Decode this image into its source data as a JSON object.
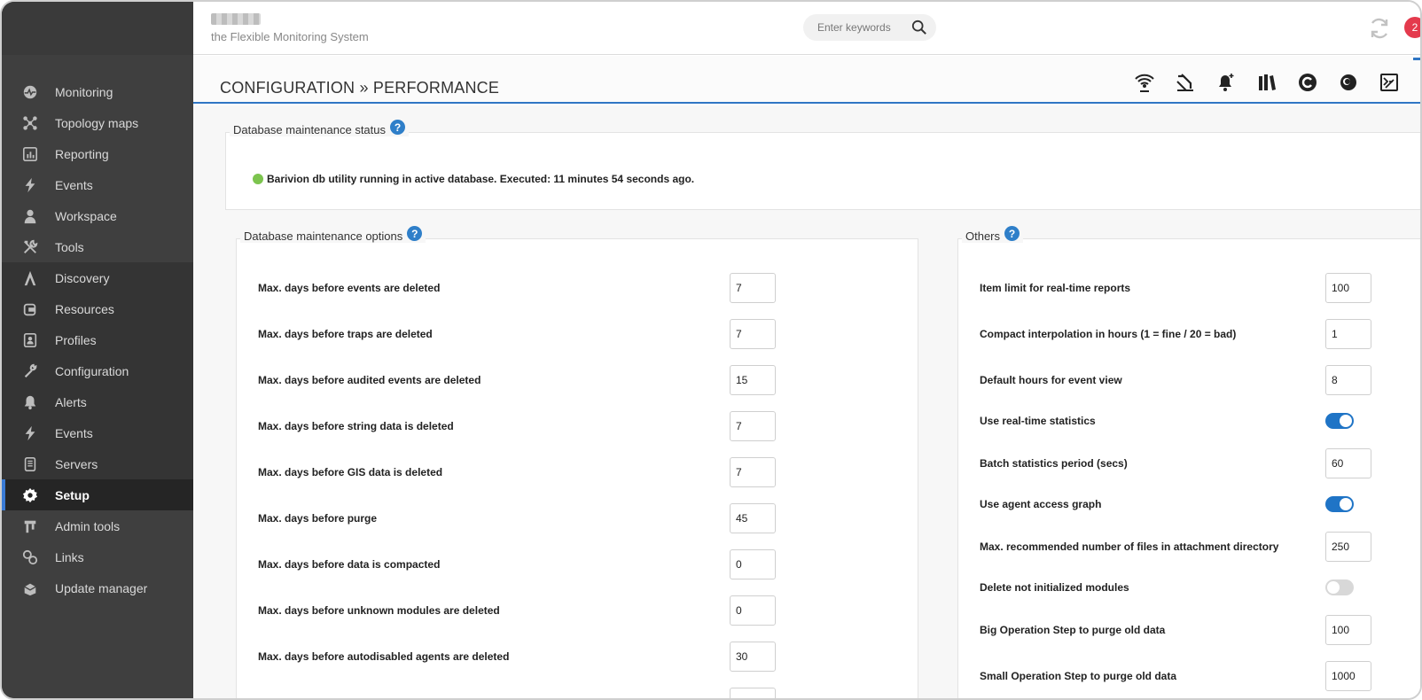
{
  "header": {
    "tagline": "the Flexible Monitoring System",
    "search_placeholder": "Enter keywords",
    "notification_count": "2"
  },
  "page": {
    "title": "CONFIGURATION » PERFORMANCE"
  },
  "sidebar": {
    "items": [
      {
        "label": "Monitoring",
        "icon": "monitoring-icon"
      },
      {
        "label": "Topology maps",
        "icon": "topology-icon"
      },
      {
        "label": "Reporting",
        "icon": "reporting-icon"
      },
      {
        "label": "Events",
        "icon": "events-icon"
      },
      {
        "label": "Workspace",
        "icon": "workspace-icon"
      },
      {
        "label": "Tools",
        "icon": "tools-icon"
      },
      {
        "label": "Discovery",
        "icon": "discovery-icon"
      },
      {
        "label": "Resources",
        "icon": "resources-icon"
      },
      {
        "label": "Profiles",
        "icon": "profiles-icon"
      },
      {
        "label": "Configuration",
        "icon": "wrench-icon"
      },
      {
        "label": "Alerts",
        "icon": "bell-icon"
      },
      {
        "label": "Events",
        "icon": "events-icon"
      },
      {
        "label": "Servers",
        "icon": "servers-icon"
      },
      {
        "label": "Setup",
        "icon": "gear-icon",
        "active": true
      },
      {
        "label": "Admin tools",
        "icon": "admin-tools-icon"
      },
      {
        "label": "Links",
        "icon": "links-icon"
      },
      {
        "label": "Update manager",
        "icon": "update-manager-icon"
      }
    ]
  },
  "db_status": {
    "legend": "Database maintenance status",
    "message": "Barivion db utility running in active database. Executed: 11 minutes 54 seconds ago.",
    "status_color": "#7cc44e"
  },
  "db_options": {
    "legend": "Database maintenance options",
    "rows": [
      {
        "label": "Max. days before events are deleted",
        "value": "7"
      },
      {
        "label": "Max. days before traps are deleted",
        "value": "7"
      },
      {
        "label": "Max. days before audited events are deleted",
        "value": "15"
      },
      {
        "label": "Max. days before string data is deleted",
        "value": "7"
      },
      {
        "label": "Max. days before GIS data is deleted",
        "value": "7"
      },
      {
        "label": "Max. days before purge",
        "value": "45"
      },
      {
        "label": "Max. days before data is compacted",
        "value": "0"
      },
      {
        "label": "Max. days before unknown modules are deleted",
        "value": "0"
      },
      {
        "label": "Max. days before autodisabled agents are deleted",
        "value": "30"
      }
    ]
  },
  "others": {
    "legend": "Others",
    "rows": [
      {
        "label": "Item limit for real-time reports",
        "type": "input",
        "value": "100"
      },
      {
        "label": "Compact interpolation in hours (1 = fine / 20 = bad)",
        "type": "input",
        "value": "1"
      },
      {
        "label": "Default hours for event view",
        "type": "input",
        "value": "8"
      },
      {
        "label": "Use real-time statistics",
        "type": "toggle",
        "value": true
      },
      {
        "label": "Batch statistics period (secs)",
        "type": "input",
        "value": "60"
      },
      {
        "label": "Use agent access graph",
        "type": "toggle",
        "value": true
      },
      {
        "label": "Max. recommended number of files in attachment directory",
        "type": "input",
        "value": "250"
      },
      {
        "label": "Delete not initialized modules",
        "type": "toggle",
        "value": false
      },
      {
        "label": "Big Operation Step to purge old data",
        "type": "input",
        "value": "100"
      },
      {
        "label": "Small Operation Step to purge old data",
        "type": "input",
        "value": "1000"
      }
    ]
  },
  "colors": {
    "sidebar_bg": "#3f3f3f",
    "accent": "#2f76c4",
    "badge": "#e43a4d",
    "toggle_on": "#1f74c6"
  }
}
